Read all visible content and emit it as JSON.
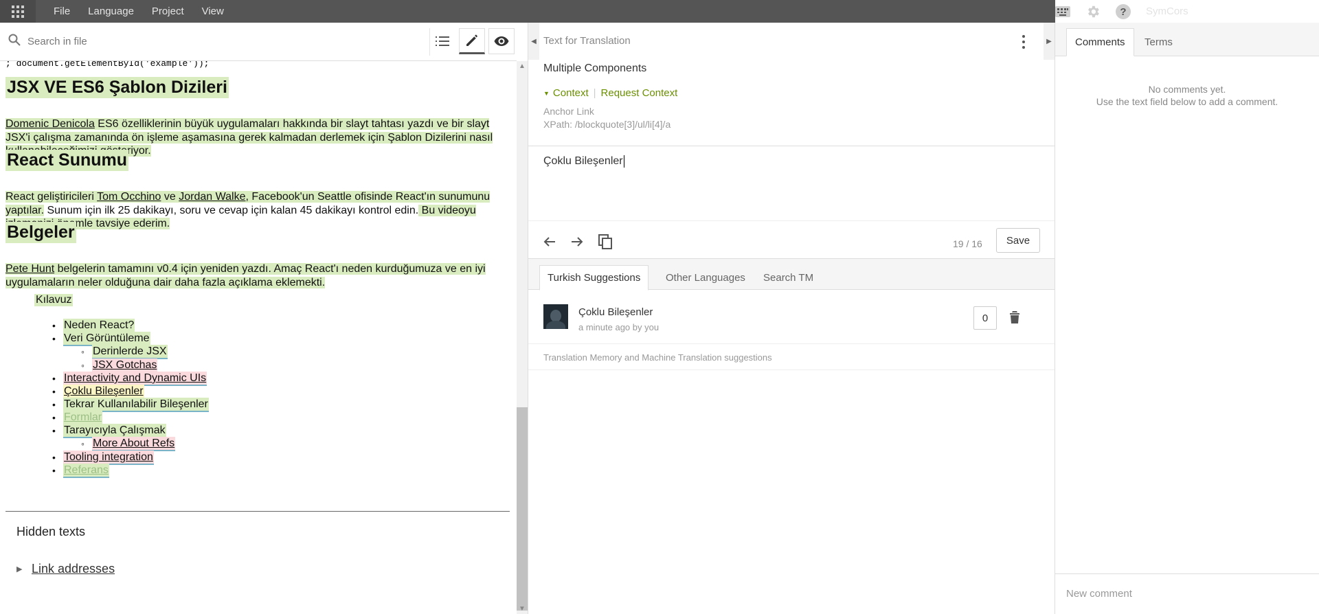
{
  "menu": {
    "file": "File",
    "language": "Language",
    "project": "Project",
    "view": "View",
    "user": "SymCors"
  },
  "left": {
    "search_placeholder": "Search in file",
    "code_line": "; document.getElementById('example'));",
    "h_jsx": "JSX VE ES6 Şablon Dizileri",
    "p1_link": "Domenic Denicola",
    "p1_rest": " ES6 özelliklerinin büyük uygulamaları hakkında bir slayt tahtası yazdı ve bir slayt JSX'i çalışma zamanında ön işleme aşamasına gerek kalmadan derlemek için Şablon Dizilerini nasıl kullanabileceğimizi gösteriyor.",
    "h_react": "React Sunumu",
    "p2_a": "React geliştiricileri ",
    "p2_link1": "Tom Occhino",
    "p2_b": " ve ",
    "p2_link2": "Jordan Walke",
    "p2_c": ", Facebook'un Seattle ofisinde React'ın sunumunu yaptılar.",
    "p2_d": " Sunum için ilk 25 dakikayı, soru ve cevap için kalan 45 dakikayı kontrol edin.",
    "p2_e": " Bu videoyu izlemenizi önemle tavsiye ederim.",
    "h_belgeler": "Belgeler",
    "p3_link": "Pete Hunt",
    "p3_a": " belgelerin tamamını v0.4 için yeniden yazdı.",
    "p3_b": " Amaç React'ı neden kurduğumuza ve en iyi uygulamaların neler olduğuna dair daha fazla açıklama eklemekti.",
    "kilavuz": "Kılavuz",
    "toc": [
      "Neden React?",
      "Veri Görüntüleme",
      "Derinlerde JSX",
      "JSX Gotchas",
      "Interactivity and Dynamic UIs",
      "Çoklu Bileşenler",
      "Tekrar Kullanılabilir Bileşenler",
      "Formlar",
      "Tarayıcıyla Çalışmak",
      "More About Refs",
      "Tooling integration",
      "Referans"
    ],
    "hidden_texts": "Hidden texts",
    "link_addresses": "Link addresses"
  },
  "mid": {
    "title": "Text for Translation",
    "source": "Multiple Components",
    "context": "Context",
    "request_context": "Request Context",
    "anchor_label": "Anchor Link",
    "xpath": "XPath: /blockquote[3]/ul/li[4]/a",
    "target": "Çoklu Bileşenler",
    "counter": "19 / 16",
    "save": "Save",
    "tabs": [
      "Turkish Suggestions",
      "Other Languages",
      "Search TM"
    ],
    "suggestion": {
      "text": "Çoklu Bileşenler",
      "meta": "a minute ago by you",
      "votes": "0"
    },
    "tm_note": "Translation Memory and Machine Translation suggestions"
  },
  "right": {
    "tabs": [
      "Comments",
      "Terms"
    ],
    "no_comments": "No comments yet.",
    "hint": "Use the text field below to add a comment.",
    "new_comment": "New comment"
  },
  "colors": {
    "topbar": "#555555",
    "highlight_green": "#d9ecbf",
    "highlight_red": "#fadadd",
    "context_green": "#6a8f00"
  }
}
